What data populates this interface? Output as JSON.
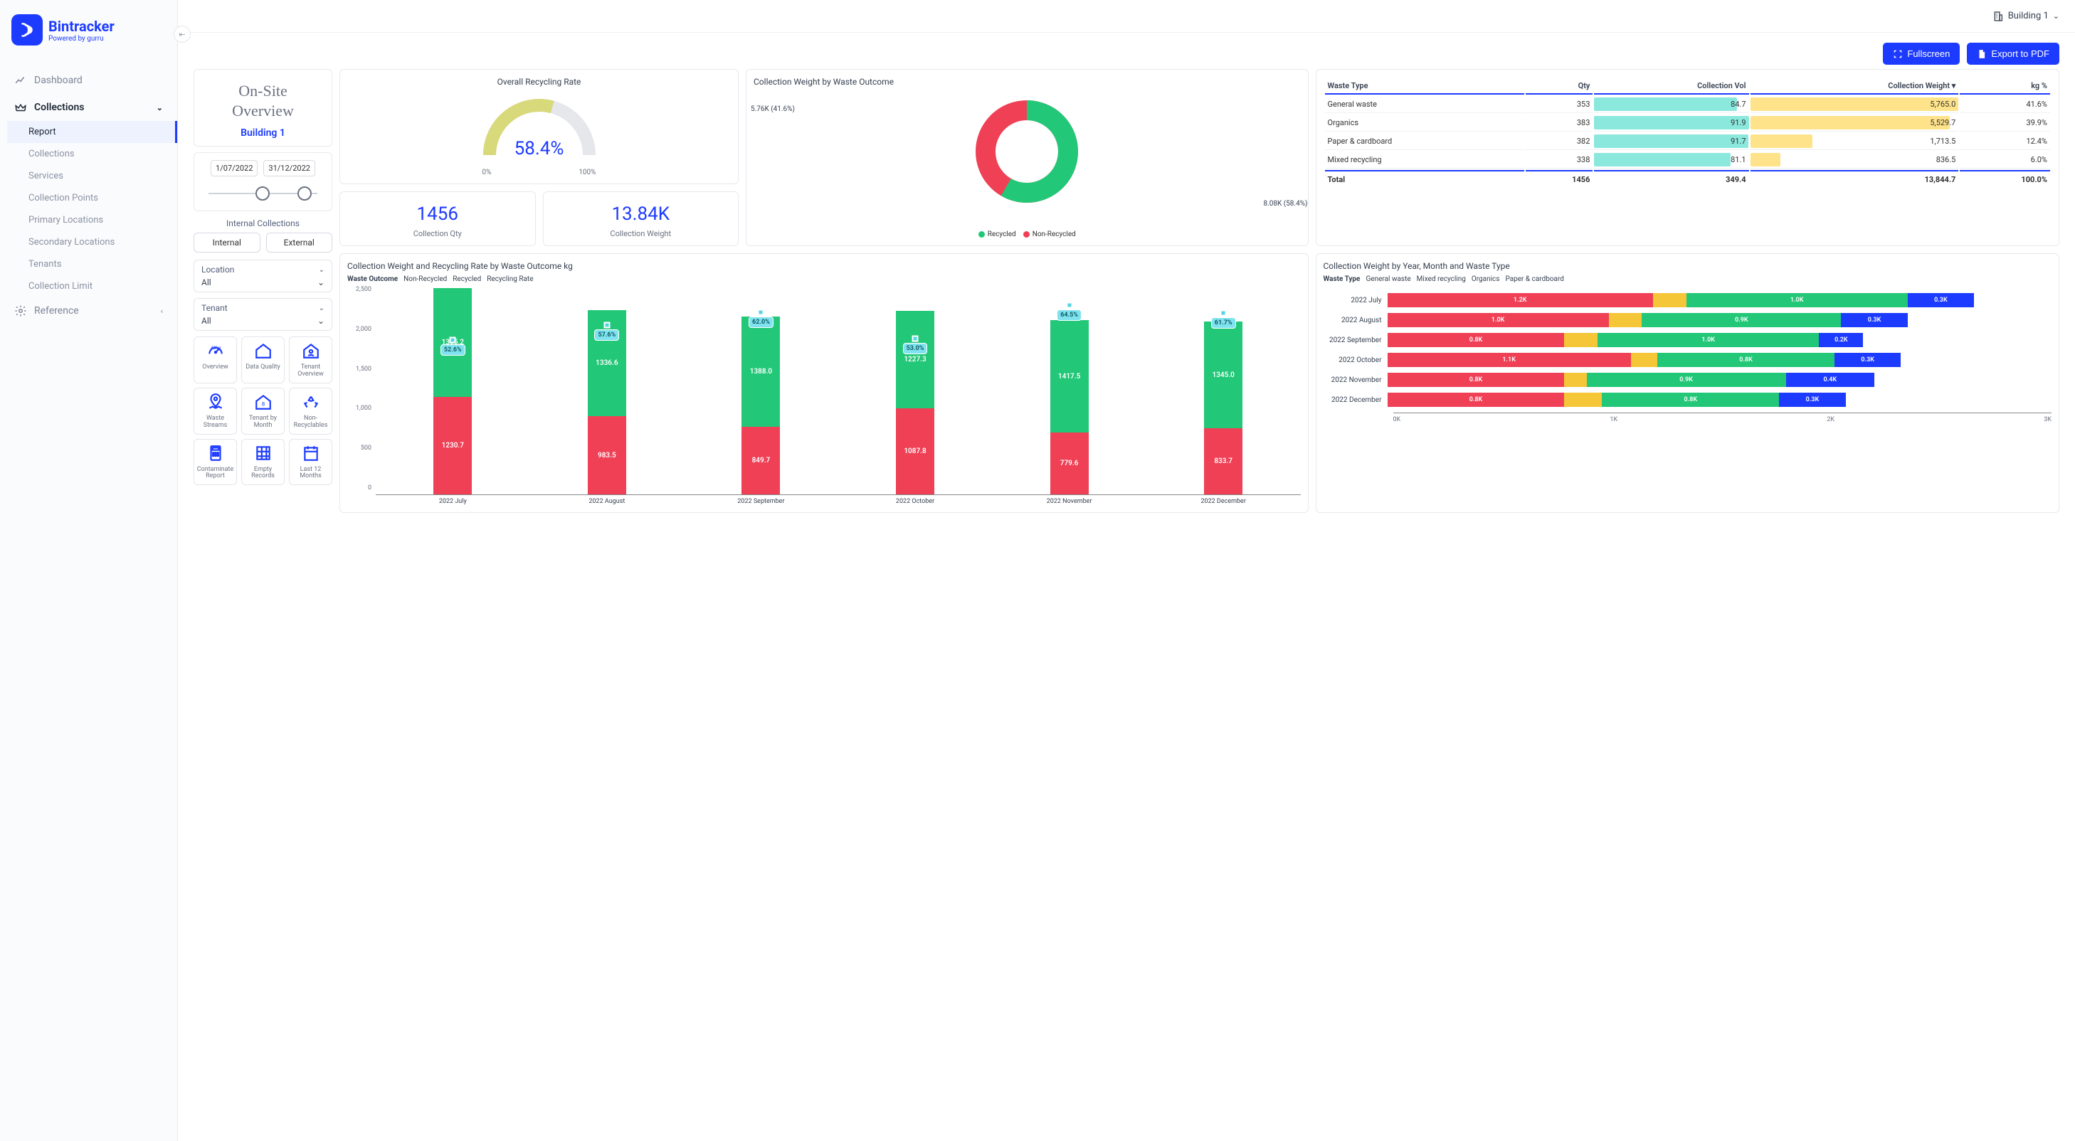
{
  "app": {
    "name": "Bintracker",
    "tagline": "Powered by gurru"
  },
  "topbar": {
    "building": "Building 1"
  },
  "nav": {
    "dashboard": "Dashboard",
    "collections": "Collections",
    "reference": "Reference",
    "sub": {
      "report": "Report",
      "collections": "Collections",
      "services": "Services",
      "points": "Collection Points",
      "primary": "Primary Locations",
      "secondary": "Secondary Locations",
      "tenants": "Tenants",
      "limit": "Collection Limit"
    }
  },
  "actions": {
    "fullscreen": "Fullscreen",
    "export": "Export to PDF"
  },
  "overview": {
    "title_1": "On-Site",
    "title_2": "Overview",
    "building": "Building 1",
    "date_from": "1/07/2022",
    "date_to": "31/12/2022",
    "internal_label": "Internal Collections",
    "internal": "Internal",
    "external": "External",
    "location_label": "Location",
    "location_value": "All",
    "tenant_label": "Tenant",
    "tenant_value": "All"
  },
  "tiles": {
    "overview": "Overview",
    "data_quality": "Data Quality",
    "tenant_overview": "Tenant Overview",
    "waste_streams": "Waste Streams",
    "tenant_month": "Tenant by Month",
    "non_recyclables": "Non-Recyclables",
    "contaminate": "Contaminate Report",
    "empty": "Empty Records",
    "last12": "Last 12 Months"
  },
  "gauge": {
    "title": "Overall Recycling Rate",
    "value": "58.4%",
    "min": "0%",
    "max": "100%",
    "pct": 58.4
  },
  "stats": {
    "qty_val": "1456",
    "qty_label": "Collection Qty",
    "wt_val": "13.84K",
    "wt_label": "Collection Weight"
  },
  "donut": {
    "title": "Collection Weight by Waste Outcome",
    "recycled_lbl": "8.08K (58.4%)",
    "nonrecycled_lbl": "5.76K (41.6%)",
    "legend_recycled": "Recycled",
    "legend_non": "Non-Recycled",
    "recycled_pct": 58.4
  },
  "waste_table": {
    "headers": {
      "type": "Waste Type",
      "qty": "Qty",
      "vol": "Collection Vol",
      "wt": "Collection Weight",
      "kgp": "kg %"
    },
    "rows": [
      {
        "type": "General waste",
        "qty": "353",
        "vol": "84.7",
        "wt": "5,765.0",
        "kgp": "41.6%",
        "vol_n": 84.7,
        "wt_n": 5765
      },
      {
        "type": "Organics",
        "qty": "383",
        "vol": "91.9",
        "wt": "5,529.7",
        "kgp": "39.9%",
        "vol_n": 91.9,
        "wt_n": 5529
      },
      {
        "type": "Paper & cardboard",
        "qty": "382",
        "vol": "91.7",
        "wt": "1,713.5",
        "kgp": "12.4%",
        "vol_n": 91.7,
        "wt_n": 1713
      },
      {
        "type": "Mixed recycling",
        "qty": "338",
        "vol": "81.1",
        "wt": "836.5",
        "kgp": "6.0%",
        "vol_n": 81.1,
        "wt_n": 836
      }
    ],
    "total": {
      "label": "Total",
      "qty": "1456",
      "vol": "349.4",
      "wt": "13,844.7",
      "kgp": "100.0%"
    }
  },
  "combo": {
    "title": "Collection Weight and Recycling Rate by Waste Outcome kg",
    "legend_head": "Waste Outcome",
    "legend_non": "Non-Recycled",
    "legend_rec": "Recycled",
    "legend_rate": "Recycling Rate",
    "y_ticks": [
      "0",
      "500",
      "1,000",
      "1,500",
      "2,000",
      "2,500"
    ]
  },
  "monthly": {
    "title": "Collection Weight by Year, Month and Waste Type",
    "legend_head": "Waste Type",
    "legend": {
      "gw": "General waste",
      "mr": "Mixed recycling",
      "org": "Organics",
      "pc": "Paper & cardboard"
    },
    "x_ticks": [
      "0K",
      "1K",
      "2K",
      "3K"
    ]
  },
  "chart_data": {
    "combo": {
      "type": "bar+line",
      "categories": [
        "2022 July",
        "2022 August",
        "2022 September",
        "2022 October",
        "2022 November",
        "2022 December"
      ],
      "series": [
        {
          "name": "Non-Recycled",
          "values": [
            1230.7,
            983.5,
            849.7,
            1087.8,
            779.6,
            833.7
          ]
        },
        {
          "name": "Recycled",
          "values": [
            1365.2,
            1336.6,
            1388.0,
            1227.3,
            1417.5,
            1345.0
          ]
        }
      ],
      "line": {
        "name": "Recycling Rate",
        "values": [
          52.6,
          57.6,
          62.0,
          53.0,
          64.5,
          61.7
        ]
      },
      "ylim": [
        0,
        2600
      ],
      "y_ticks": [
        0,
        500,
        1000,
        1500,
        2000,
        2500
      ]
    },
    "monthly": {
      "type": "stacked-hbar",
      "x_max": 3000,
      "categories": [
        "2022 July",
        "2022 August",
        "2022 September",
        "2022 October",
        "2022 November",
        "2022 December"
      ],
      "series": [
        {
          "name": "General waste",
          "color": "#ef4056",
          "values": [
            1200,
            1000,
            800,
            1100,
            800,
            800
          ]
        },
        {
          "name": "Mixed recycling",
          "color": "#f4c638",
          "values": [
            150,
            150,
            150,
            120,
            100,
            170
          ]
        },
        {
          "name": "Organics",
          "color": "#22c777",
          "values": [
            1000,
            900,
            1000,
            800,
            900,
            800
          ]
        },
        {
          "name": "Paper & cardboard",
          "color": "#1d3bff",
          "values": [
            300,
            300,
            200,
            300,
            400,
            300
          ]
        }
      ],
      "show_labels": [
        [
          "1.2K",
          null,
          "1.0K",
          "0.3K"
        ],
        [
          "1.0K",
          null,
          "0.9K",
          "0.3K"
        ],
        [
          "0.8K",
          null,
          "1.0K",
          "0.2K"
        ],
        [
          "1.1K",
          null,
          "0.8K",
          "0.3K"
        ],
        [
          "0.8K",
          null,
          "0.9K",
          "0.4K"
        ],
        [
          "0.8K",
          null,
          "0.8K",
          "0.3K"
        ]
      ]
    },
    "donut": {
      "type": "pie",
      "slices": [
        {
          "name": "Recycled",
          "value": 8080
        },
        {
          "name": "Non-Recycled",
          "value": 5760
        }
      ]
    },
    "gauge": {
      "type": "gauge",
      "value": 58.4,
      "range": [
        0,
        100
      ]
    }
  }
}
